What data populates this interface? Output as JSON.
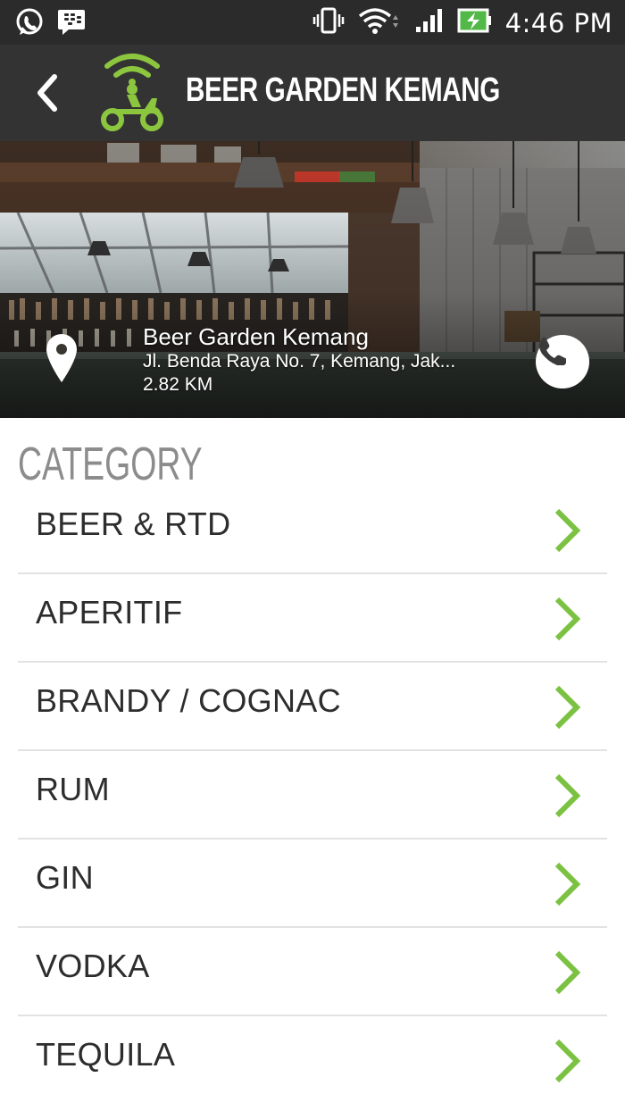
{
  "status_bar": {
    "time": "4:46 PM",
    "left_icons": [
      "whatsapp-icon",
      "bbm-icon"
    ],
    "right_icons": [
      "vibrate-icon",
      "wifi-icon",
      "signal-icon",
      "battery-charging-icon"
    ]
  },
  "header": {
    "title": "BEER GARDEN KEMANG",
    "back_icon": "chevron-left-icon",
    "logo_icon": "scooter-delivery-logo",
    "accent_color": "#8cc63f"
  },
  "venue": {
    "name": "Beer Garden Kemang",
    "address": "Jl. Benda Raya No. 7, Kemang, Jak...",
    "distance": "2.82 KM",
    "pin_icon": "map-pin-icon",
    "call_icon": "phone-icon"
  },
  "category": {
    "heading": "CATEGORY",
    "items": [
      {
        "label": "BEER & RTD"
      },
      {
        "label": "APERITIF"
      },
      {
        "label": "BRANDY / COGNAC"
      },
      {
        "label": "RUM"
      },
      {
        "label": "GIN"
      },
      {
        "label": "VODKA"
      },
      {
        "label": "TEQUILA"
      }
    ],
    "chevron_color": "#7cc242"
  }
}
